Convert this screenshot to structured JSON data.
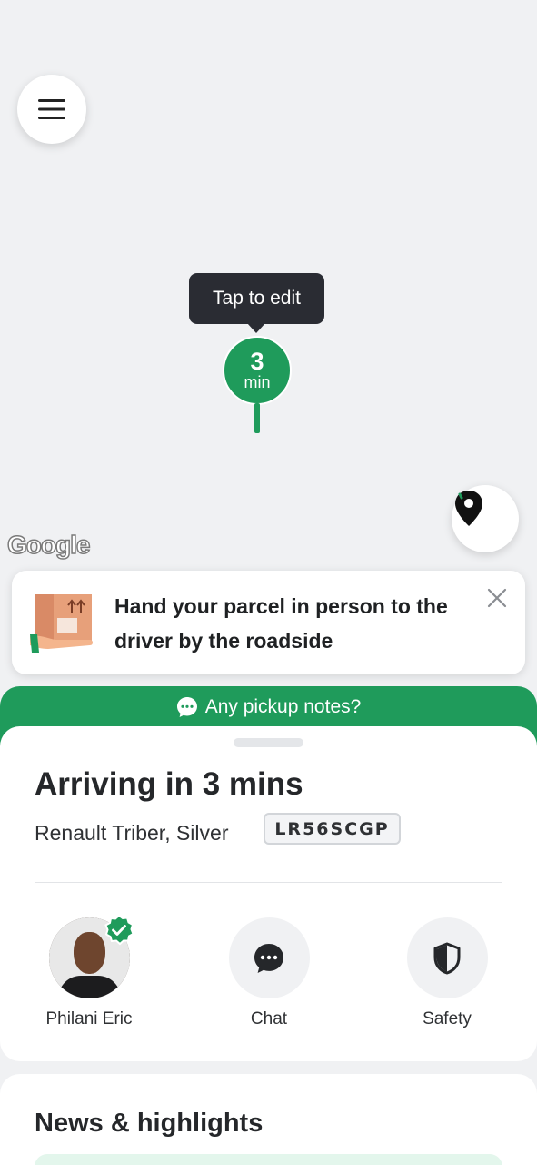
{
  "map": {
    "tooltip": "Tap to edit",
    "eta_value": "3",
    "eta_unit": "min",
    "attribution": "Google",
    "colors": {
      "accent": "#1f9b5b",
      "tooltip_bg": "#2a2c33"
    },
    "icons": {
      "menu": "hamburger-menu-icon",
      "locate": "location-pin-icon"
    }
  },
  "banner": {
    "text": "Hand your parcel in person to the driver by the roadside",
    "icons": {
      "illustration": "parcel-hand-icon",
      "close": "close-icon"
    }
  },
  "notes": {
    "label": "Any pickup notes?",
    "icon": "chat-bubble-icon"
  },
  "trip": {
    "title": "Arriving in 3 mins",
    "vehicle": "Renault Triber, Silver",
    "plate": "LR56SCGP"
  },
  "actions": [
    {
      "label": "Philani Eric",
      "icon": "driver-avatar",
      "verified": true
    },
    {
      "label": "Chat",
      "icon": "chat-icon"
    },
    {
      "label": "Safety",
      "icon": "shield-icon"
    }
  ],
  "news": {
    "title": "News & highlights"
  }
}
